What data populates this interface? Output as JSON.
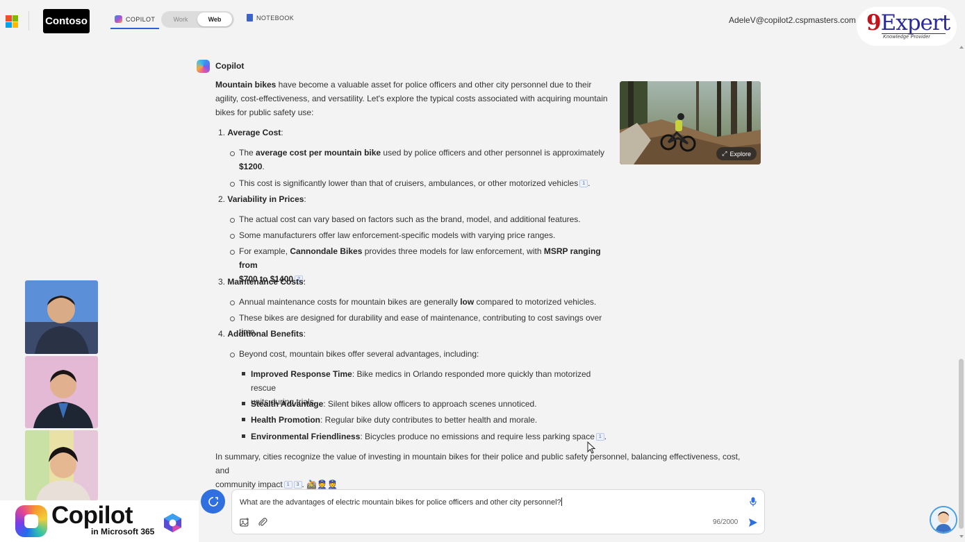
{
  "header": {
    "brand": "Contoso",
    "tab_copilot": "COPILOT",
    "toggle_work": "Work",
    "toggle_web": "Web",
    "tab_notebook": "NOTEBOOK",
    "user_email": "AdeleV@copilot2.cspmasters.com",
    "badge_main_9": "9",
    "badge_main_rest": "Expert",
    "badge_sub": "Knowledge Provider"
  },
  "response": {
    "sender": "Copilot",
    "intro_bold": "Mountain bikes",
    "intro_rest": " have become a valuable asset for police officers and other city personnel due to their agility, cost-effectiveness, and versatility. Let's explore the typical costs associated with acquiring mountain bikes for public safety use:",
    "s1_num": "1.",
    "s1_title": "Average Cost",
    "s1_b1_a": "The ",
    "s1_b1_bold": "average cost per mountain bike",
    "s1_b1_b": " used by police officers and other personnel is approximately",
    "s1_b1_value": "$1200",
    "s1_b2": "This cost is significantly lower than that of cruisers, ambulances, or other motorized vehicles",
    "s2_num": "2.",
    "s2_title": "Variability in Prices",
    "s2_b1": "The actual cost can vary based on factors such as the brand, model, and additional features.",
    "s2_b2": "Some manufacturers offer law enforcement-specific models with varying price ranges.",
    "s2_b3_a": "For example, ",
    "s2_b3_bold1": "Cannondale Bikes",
    "s2_b3_b": " provides three models for law enforcement, with ",
    "s2_b3_bold2": "MSRP ranging from",
    "s2_b3_bold3": "$700 to $1400",
    "s3_num": "3.",
    "s3_title": "Maintenance Costs",
    "s3_b1_a": "Annual maintenance costs for mountain bikes are generally ",
    "s3_b1_bold": "low",
    "s3_b1_b": " compared to motorized vehicles.",
    "s3_b2": "These bikes are designed for durability and ease of maintenance, contributing to cost savings over time.",
    "s4_num": "4.",
    "s4_title": "Additional Benefits",
    "s4_b1": "Beyond cost, mountain bikes offer several advantages, including:",
    "s4_sq1_bold": "Improved Response Time",
    "s4_sq1_a": ": Bike medics in Orlando responded more quickly than motorized rescue",
    "s4_sq1_b": "units during trials.",
    "s4_sq2_bold": "Stealth Advantage",
    "s4_sq2": ": Silent bikes allow officers to approach scenes unnoticed.",
    "s4_sq3_bold": "Health Promotion",
    "s4_sq3": ": Regular bike duty contributes to better health and morale.",
    "s4_sq4_bold": "Environmental Friendliness",
    "s4_sq4": ": Bicycles produce no emissions and require less parking space",
    "summary_a": "In summary, cities recognize the value of investing in mountain bikes for their police and public safety personnel, balancing effectiveness, cost, and",
    "summary_b": "community impact",
    "summary_emoji": "🚵👮👮",
    "cite1": "1",
    "cite2": "2",
    "cite3": "3",
    "explore_label": "Explore"
  },
  "input": {
    "text": "What are the advantages of electric mountain bikes for police officers and other city personnel?",
    "counter": "96/2000"
  },
  "branding": {
    "title": "Copilot",
    "subtitle": "in Microsoft 365"
  },
  "colors": {
    "accent": "#2f6fdf",
    "ms_red": "#f25022",
    "ms_green": "#7fba00",
    "ms_blue": "#00a4ef",
    "ms_yellow": "#ffb900"
  },
  "icons": [
    "microsoft-logo",
    "copilot-icon",
    "notebook-icon",
    "wand-icon",
    "new-topic-icon",
    "mic-icon",
    "image-icon",
    "paperclip-icon",
    "send-icon"
  ]
}
